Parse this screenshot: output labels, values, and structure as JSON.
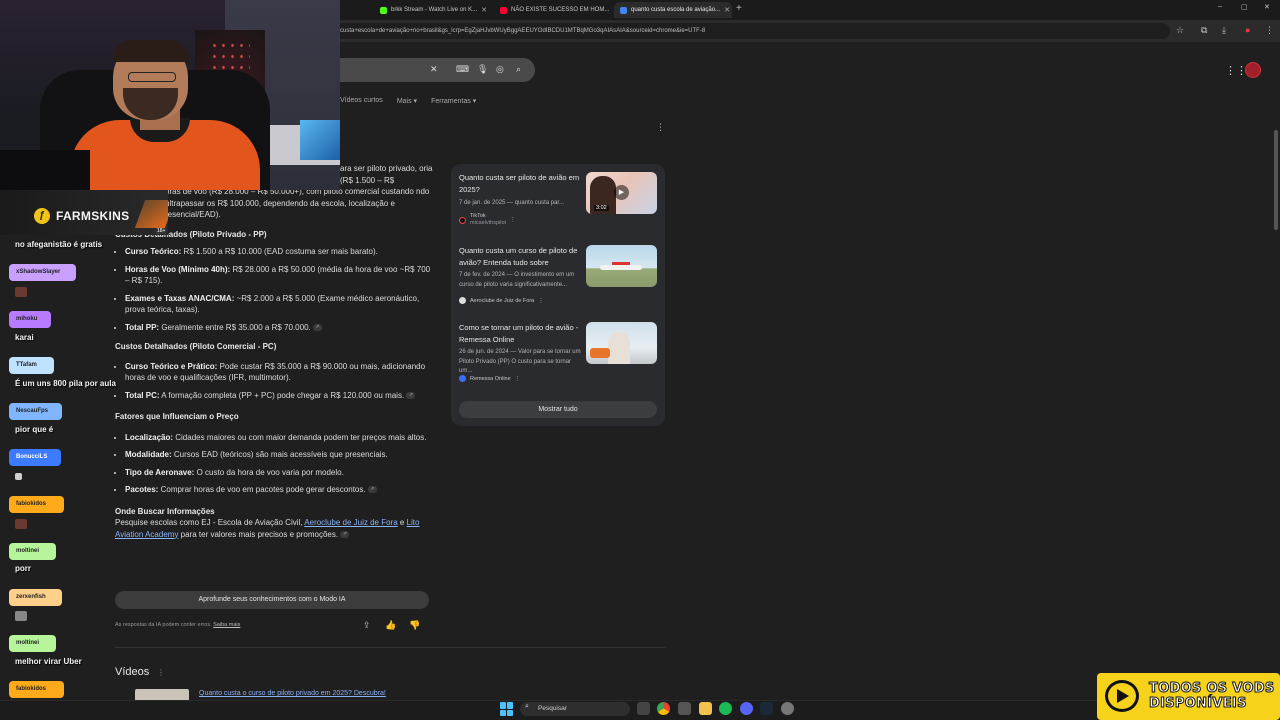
{
  "browser": {
    "tabs": [
      {
        "label": "brkk Stream - Watch Live on K...",
        "color": "#53fc18"
      },
      {
        "label": "NÃO EXISTE SUCESSO EM HOM...",
        "color": "#ff0033"
      },
      {
        "label": "quanto custa escola de aviação...",
        "color": "#4285f4"
      }
    ],
    "new_tab": "+",
    "url": "custa+escola+de+aviação+no+brasil&gs_lcrp=EgZjaHJvbWUyBggAEEUYOdIBCDU1MTBqMGo3qAIAsAIA&sourceid=chrome&ie=UTF-8",
    "window_controls": [
      "–",
      "▢",
      "✕"
    ]
  },
  "google": {
    "nav_tabs": [
      "Vídeos curtos",
      "Mais",
      "Ferramentas"
    ],
    "ai_intro": "ara ser piloto privado, oria (R$ 1.500 – R$",
    "ai_intro_rest": "oras de voo (R$ 28.000 – R$ 50.000+), com piloto comercial custando ndo ultrapassar os R$ 100.000, dependendo da escola, localização e resencial/EAD).",
    "sections": {
      "pp_title": "Custos Detalhados (Piloto Privado - PP)",
      "pp_items": [
        {
          "b": "Curso Teórico:",
          "t": "R$ 1.500 a R$ 10.000 (EAD costuma ser mais barato)."
        },
        {
          "b": "Horas de Voo (Mínimo 40h):",
          "t": "R$ 28.000 a R$ 50.000 (média da hora de voo ~R$ 700 – R$ 715)."
        },
        {
          "b": "Exames e Taxas ANAC/CMA:",
          "t": "~R$ 2.000 a R$ 5.000 (Exame médico aeronáutico, prova teórica, taxas)."
        },
        {
          "b": "Total PP:",
          "t": "Geralmente entre R$ 35.000 a R$ 70.000."
        }
      ],
      "pc_title": "Custos Detalhados (Piloto Comercial - PC)",
      "pc_items": [
        {
          "b": "Curso Teórico e Prático:",
          "t": "Pode custar R$ 35.000 a R$ 90.000 ou mais, adicionando horas de voo e qualificações (IFR, multimotor)."
        },
        {
          "b": "Total PC:",
          "t": "A formação completa (PP + PC) pode chegar a R$ 120.000 ou mais."
        }
      ],
      "factors_title": "Fatores que Influenciam o Preço",
      "factors_items": [
        {
          "b": "Localização:",
          "t": "Cidades maiores ou com maior demanda podem ter preços mais altos."
        },
        {
          "b": "Modalidade:",
          "t": "Cursos EAD (teóricos) são mais acessíveis que presenciais."
        },
        {
          "b": "Tipo de Aeronave:",
          "t": "O custo da hora de voo varia por modelo."
        },
        {
          "b": "Pacotes:",
          "t": "Comprar horas de voo em pacotes pode gerar descontos."
        }
      ],
      "where_title": "Onde Buscar Informações",
      "where_pre": "Pesquise escolas como EJ - Escola de Aviação Civil, ",
      "where_link1": "Aeroclube de Juiz de Fora",
      "where_mid": " e ",
      "where_link2": "Lito Aviation Academy",
      "where_post": " para ter valores mais precisos e promoções."
    },
    "deep_button": "Aprofunde seus conhecimentos com o Modo IA",
    "disclaimer": "As respostas da IA podem conter erros.",
    "disclaimer_link": "Saiba mais",
    "videos_heading": "Vídeos",
    "videos_kebab": "⋮",
    "video_link": "Quanto custa o curso de piloto privado em 2025? Descubra!",
    "sources": [
      {
        "title": "Quanto custa ser piloto de avião em 2025?",
        "snippet": "7 de jan. de 2025 — quanto custa par...",
        "site": "TikTok",
        "site_sub": "micaelvthspilot",
        "duration": "3:02"
      },
      {
        "title": "Quanto custa um curso de piloto de avião? Entenda tudo sobre",
        "snippet": "7 de fev. de 2024 — O investimento em um curso de piloto varia significativamente...",
        "site": "Aeroclube de Juiz de Fora"
      },
      {
        "title": "Como se tornar um piloto de avião - Remessa Online",
        "snippet": "26 de jun. de 2024 — Valor para se tornar um Piloto Privado (PP) O custo para se tornar um...",
        "site": "Remessa Online"
      }
    ],
    "show_all": "Mostrar tudo"
  },
  "overlay": {
    "sponsor": "FARMSKINS",
    "sponsor_age": "18+",
    "chat": [
      {
        "user": "",
        "msg": "no afeganistão é gratis",
        "color": ""
      },
      {
        "user": "xShadowSlayer",
        "msg": "",
        "color": "#c9a0ff"
      },
      {
        "user": "mihoku",
        "msg": "karai",
        "color": "#b77bff"
      },
      {
        "user": "TTafam",
        "msg": "É um uns 800 pila por aula",
        "color": "#bfe3ff"
      },
      {
        "user": "NescauFps",
        "msg": "pior que é",
        "color": "#7fb6ff"
      },
      {
        "user": "BonucciLS",
        "msg": "",
        "color": "#3c7bff"
      },
      {
        "user": "fabiokidos",
        "msg": "",
        "color": "#ffaa1a"
      },
      {
        "user": "moltinei",
        "msg": "porr",
        "color": "#b6f59a"
      },
      {
        "user": "zerxenfish",
        "msg": "",
        "color": "#ffd08a"
      },
      {
        "user": "moltinei",
        "msg": "melhor virar Uber",
        "color": "#b6f59a"
      },
      {
        "user": "fabiokidos",
        "msg": "",
        "color": "#ffaa1a"
      }
    ],
    "badge_line1": "TODOS OS VODS",
    "badge_line2": "DISPONÍVEIS"
  },
  "taskbar": {
    "search_placeholder": "Pesquisar"
  }
}
